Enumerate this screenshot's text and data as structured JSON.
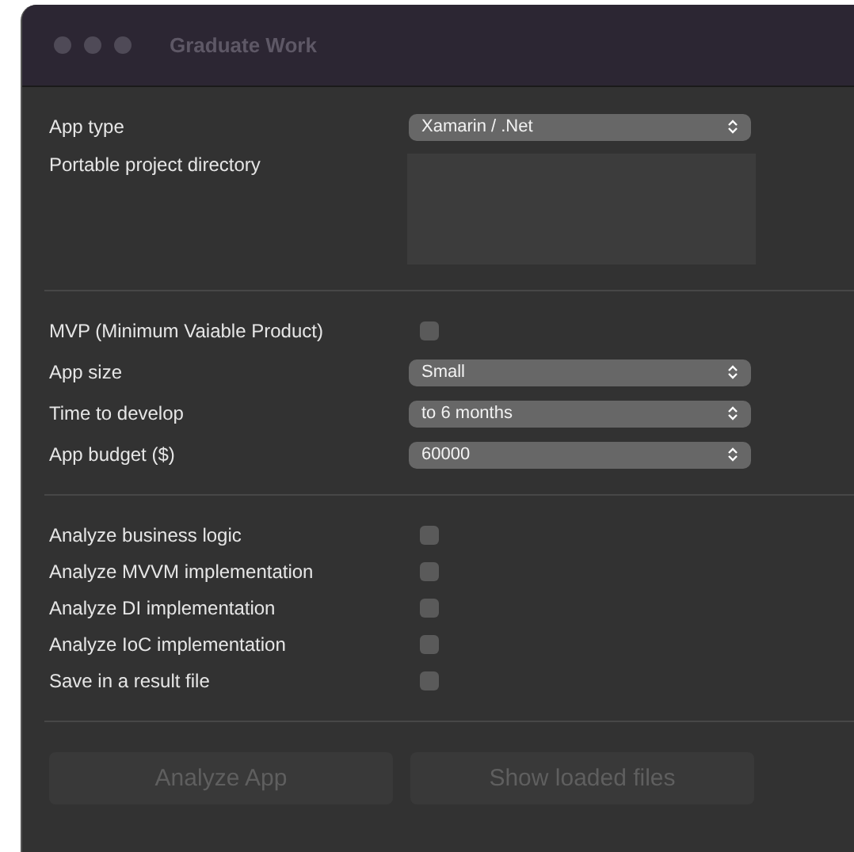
{
  "window": {
    "title": "Graduate Work"
  },
  "sections": [
    {
      "rows": [
        {
          "kind": "select",
          "label": "App type",
          "value": "Xamarin / .Net"
        },
        {
          "kind": "textarea",
          "label": "Portable project directory"
        }
      ]
    },
    {
      "rows": [
        {
          "kind": "checkbox",
          "label": "MVP (Minimum Vaiable Product)",
          "checked": false
        },
        {
          "kind": "select",
          "label": "App size",
          "value": "Small"
        },
        {
          "kind": "select",
          "label": "Time to develop",
          "value": "to 6 months"
        },
        {
          "kind": "select",
          "label": "App budget ($)",
          "value": "60000"
        }
      ]
    },
    {
      "rows": [
        {
          "kind": "checkbox",
          "label": "Analyze business logic",
          "checked": false
        },
        {
          "kind": "checkbox",
          "label": "Analyze MVVM implementation",
          "checked": false
        },
        {
          "kind": "checkbox",
          "label": "Analyze DI implementation",
          "checked": false
        },
        {
          "kind": "checkbox",
          "label": "Analyze IoC implementation",
          "checked": false
        },
        {
          "kind": "checkbox",
          "label": "Save in a result file",
          "checked": false
        }
      ]
    }
  ],
  "buttons": [
    {
      "label": "Analyze App",
      "disabled": true
    },
    {
      "label": "Show loaded files",
      "disabled": true
    }
  ]
}
